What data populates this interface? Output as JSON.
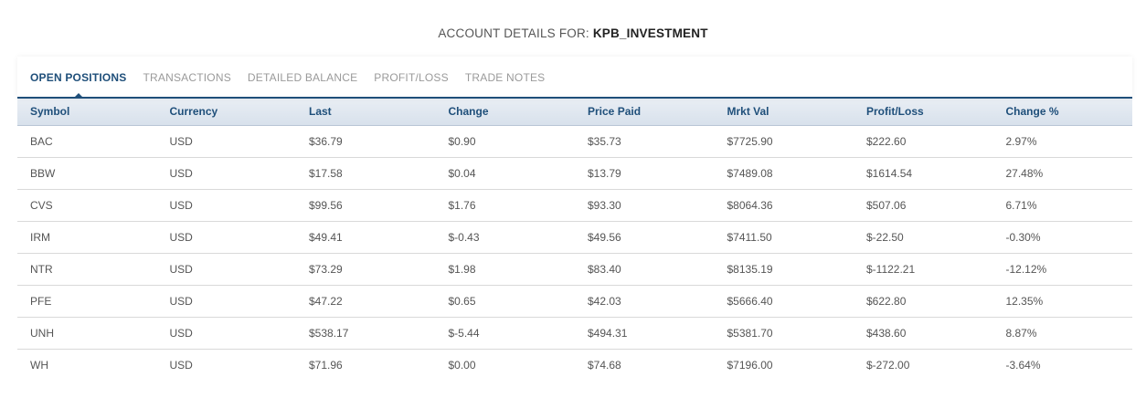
{
  "header": {
    "title_prefix": "ACCOUNT DETAILS FOR:",
    "account_name": "KPB_INVESTMENT"
  },
  "tabs": [
    {
      "label": "OPEN POSITIONS",
      "active": true
    },
    {
      "label": "TRANSACTIONS",
      "active": false
    },
    {
      "label": "DETAILED BALANCE",
      "active": false
    },
    {
      "label": "PROFIT/LOSS",
      "active": false
    },
    {
      "label": "TRADE NOTES",
      "active": false
    }
  ],
  "table": {
    "columns": [
      "Symbol",
      "Currency",
      "Last",
      "Change",
      "Price Paid",
      "Mrkt Val",
      "Profit/Loss",
      "Change %"
    ],
    "rows": [
      [
        "BAC",
        "USD",
        "$36.79",
        "$0.90",
        "$35.73",
        "$7725.90",
        "$222.60",
        "2.97%"
      ],
      [
        "BBW",
        "USD",
        "$17.58",
        "$0.04",
        "$13.79",
        "$7489.08",
        "$1614.54",
        "27.48%"
      ],
      [
        "CVS",
        "USD",
        "$99.56",
        "$1.76",
        "$93.30",
        "$8064.36",
        "$507.06",
        "6.71%"
      ],
      [
        "IRM",
        "USD",
        "$49.41",
        "$-0.43",
        "$49.56",
        "$7411.50",
        "$-22.50",
        "-0.30%"
      ],
      [
        "NTR",
        "USD",
        "$73.29",
        "$1.98",
        "$83.40",
        "$8135.19",
        "$-1122.21",
        "-12.12%"
      ],
      [
        "PFE",
        "USD",
        "$47.22",
        "$0.65",
        "$42.03",
        "$5666.40",
        "$622.80",
        "12.35%"
      ],
      [
        "UNH",
        "USD",
        "$538.17",
        "$-5.44",
        "$494.31",
        "$5381.70",
        "$438.60",
        "8.87%"
      ],
      [
        "WH",
        "USD",
        "$71.96",
        "$0.00",
        "$74.68",
        "$7196.00",
        "$-272.00",
        "-3.64%"
      ]
    ]
  },
  "colors": {
    "accent": "#1f4f7a",
    "header_bg": "#dfe6ef",
    "row_border": "#d9d9d9"
  }
}
